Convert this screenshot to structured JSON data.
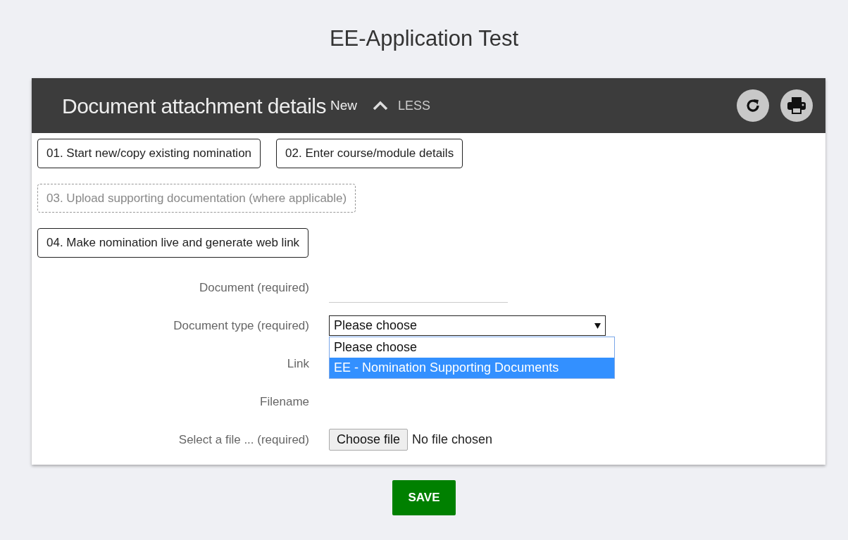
{
  "page_title": "EE-Application Test",
  "panel": {
    "title": "Document attachment details",
    "badge": "New",
    "toggle": {
      "label": "LESS",
      "expanded": true
    }
  },
  "steps": [
    {
      "label": "01. Start new/copy existing nomination",
      "disabled": false
    },
    {
      "label": "02. Enter course/module details",
      "disabled": false
    },
    {
      "label": "03. Upload supporting documentation (where applicable)",
      "disabled": true
    },
    {
      "label": "04. Make nomination live and generate web link",
      "disabled": false
    }
  ],
  "fields": [
    {
      "kind": "text",
      "label": "Document",
      "note": "(required)"
    },
    {
      "kind": "select",
      "label": "Document type",
      "note": "(required)",
      "value": "Please choose",
      "open": true,
      "options": [
        {
          "label": "Please choose",
          "selected": true,
          "highlighted": false
        },
        {
          "label": "EE - Nomination Supporting Documents",
          "selected": false,
          "highlighted": true
        }
      ]
    },
    {
      "kind": "static",
      "label": "Link"
    },
    {
      "kind": "static",
      "label": "Filename"
    },
    {
      "kind": "file",
      "label": "Select a file ...",
      "note": "(required)",
      "button": "Choose file",
      "status": "No file chosen"
    }
  ],
  "save_button": "SAVE"
}
